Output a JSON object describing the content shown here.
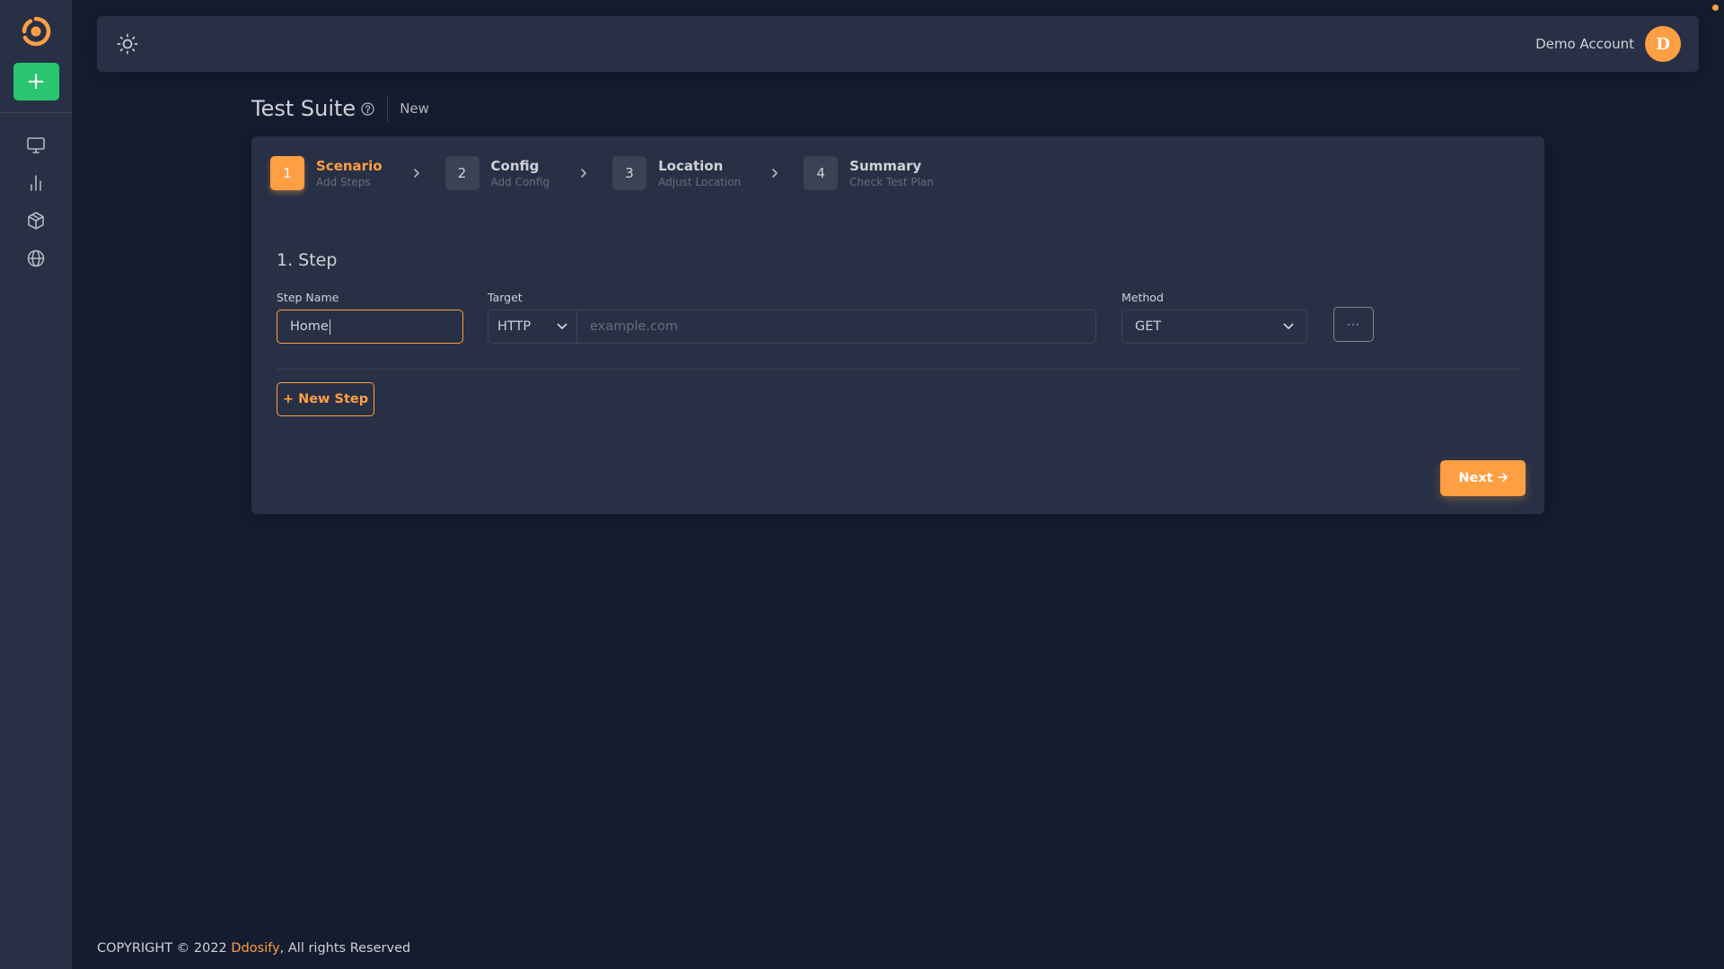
{
  "colors": {
    "accent": "#ff9f43",
    "success": "#28c76f",
    "panel": "#283046",
    "background": "#151c2f"
  },
  "sidebar": {
    "logo_icon": "ddosify-logo-icon",
    "new_button_label": "+",
    "items": [
      {
        "icon": "monitor-icon"
      },
      {
        "icon": "bar-chart-icon"
      },
      {
        "icon": "box-icon"
      },
      {
        "icon": "globe-icon"
      }
    ]
  },
  "header": {
    "theme_icon": "sun-icon",
    "user_name": "Demo Account",
    "avatar_initial": "D"
  },
  "page": {
    "title": "Test Suite",
    "help_icon": "help-circle-icon",
    "breadcrumb": "New"
  },
  "stepper": [
    {
      "number": "1",
      "title": "Scenario",
      "subtitle": "Add Steps",
      "active": true
    },
    {
      "number": "2",
      "title": "Config",
      "subtitle": "Add Config",
      "active": false
    },
    {
      "number": "3",
      "title": "Location",
      "subtitle": "Adjust Location",
      "active": false
    },
    {
      "number": "4",
      "title": "Summary",
      "subtitle": "Check Test Plan",
      "active": false
    }
  ],
  "step_form": {
    "heading": "1. Step",
    "step_name_label": "Step Name",
    "step_name_value": "Home",
    "target_label": "Target",
    "protocol_value": "HTTP",
    "target_placeholder": "example.com",
    "method_label": "Method",
    "method_value": "GET",
    "more_label": "···",
    "new_step_label": "+ New Step",
    "next_label": "Next"
  },
  "footer": {
    "prefix": "COPYRIGHT © 2022 ",
    "brand": "Ddosify",
    "suffix": ", All rights Reserved"
  }
}
